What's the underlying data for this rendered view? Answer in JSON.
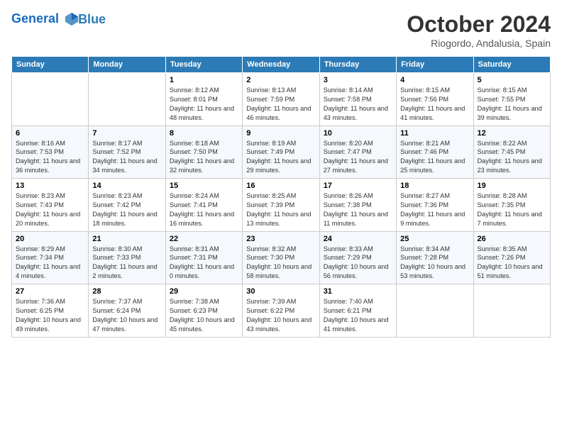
{
  "logo": {
    "line1": "General",
    "line2": "Blue"
  },
  "title": "October 2024",
  "subtitle": "Riogordo, Andalusia, Spain",
  "days_of_week": [
    "Sunday",
    "Monday",
    "Tuesday",
    "Wednesday",
    "Thursday",
    "Friday",
    "Saturday"
  ],
  "weeks": [
    [
      {
        "day": "",
        "sunrise": "",
        "sunset": "",
        "daylight": ""
      },
      {
        "day": "",
        "sunrise": "",
        "sunset": "",
        "daylight": ""
      },
      {
        "day": "1",
        "sunrise": "Sunrise: 8:12 AM",
        "sunset": "Sunset: 8:01 PM",
        "daylight": "Daylight: 11 hours and 48 minutes."
      },
      {
        "day": "2",
        "sunrise": "Sunrise: 8:13 AM",
        "sunset": "Sunset: 7:59 PM",
        "daylight": "Daylight: 11 hours and 46 minutes."
      },
      {
        "day": "3",
        "sunrise": "Sunrise: 8:14 AM",
        "sunset": "Sunset: 7:58 PM",
        "daylight": "Daylight: 11 hours and 43 minutes."
      },
      {
        "day": "4",
        "sunrise": "Sunrise: 8:15 AM",
        "sunset": "Sunset: 7:56 PM",
        "daylight": "Daylight: 11 hours and 41 minutes."
      },
      {
        "day": "5",
        "sunrise": "Sunrise: 8:15 AM",
        "sunset": "Sunset: 7:55 PM",
        "daylight": "Daylight: 11 hours and 39 minutes."
      }
    ],
    [
      {
        "day": "6",
        "sunrise": "Sunrise: 8:16 AM",
        "sunset": "Sunset: 7:53 PM",
        "daylight": "Daylight: 11 hours and 36 minutes."
      },
      {
        "day": "7",
        "sunrise": "Sunrise: 8:17 AM",
        "sunset": "Sunset: 7:52 PM",
        "daylight": "Daylight: 11 hours and 34 minutes."
      },
      {
        "day": "8",
        "sunrise": "Sunrise: 8:18 AM",
        "sunset": "Sunset: 7:50 PM",
        "daylight": "Daylight: 11 hours and 32 minutes."
      },
      {
        "day": "9",
        "sunrise": "Sunrise: 8:19 AM",
        "sunset": "Sunset: 7:49 PM",
        "daylight": "Daylight: 11 hours and 29 minutes."
      },
      {
        "day": "10",
        "sunrise": "Sunrise: 8:20 AM",
        "sunset": "Sunset: 7:47 PM",
        "daylight": "Daylight: 11 hours and 27 minutes."
      },
      {
        "day": "11",
        "sunrise": "Sunrise: 8:21 AM",
        "sunset": "Sunset: 7:46 PM",
        "daylight": "Daylight: 11 hours and 25 minutes."
      },
      {
        "day": "12",
        "sunrise": "Sunrise: 8:22 AM",
        "sunset": "Sunset: 7:45 PM",
        "daylight": "Daylight: 11 hours and 23 minutes."
      }
    ],
    [
      {
        "day": "13",
        "sunrise": "Sunrise: 8:23 AM",
        "sunset": "Sunset: 7:43 PM",
        "daylight": "Daylight: 11 hours and 20 minutes."
      },
      {
        "day": "14",
        "sunrise": "Sunrise: 8:23 AM",
        "sunset": "Sunset: 7:42 PM",
        "daylight": "Daylight: 11 hours and 18 minutes."
      },
      {
        "day": "15",
        "sunrise": "Sunrise: 8:24 AM",
        "sunset": "Sunset: 7:41 PM",
        "daylight": "Daylight: 11 hours and 16 minutes."
      },
      {
        "day": "16",
        "sunrise": "Sunrise: 8:25 AM",
        "sunset": "Sunset: 7:39 PM",
        "daylight": "Daylight: 11 hours and 13 minutes."
      },
      {
        "day": "17",
        "sunrise": "Sunrise: 8:26 AM",
        "sunset": "Sunset: 7:38 PM",
        "daylight": "Daylight: 11 hours and 11 minutes."
      },
      {
        "day": "18",
        "sunrise": "Sunrise: 8:27 AM",
        "sunset": "Sunset: 7:36 PM",
        "daylight": "Daylight: 11 hours and 9 minutes."
      },
      {
        "day": "19",
        "sunrise": "Sunrise: 8:28 AM",
        "sunset": "Sunset: 7:35 PM",
        "daylight": "Daylight: 11 hours and 7 minutes."
      }
    ],
    [
      {
        "day": "20",
        "sunrise": "Sunrise: 8:29 AM",
        "sunset": "Sunset: 7:34 PM",
        "daylight": "Daylight: 11 hours and 4 minutes."
      },
      {
        "day": "21",
        "sunrise": "Sunrise: 8:30 AM",
        "sunset": "Sunset: 7:33 PM",
        "daylight": "Daylight: 11 hours and 2 minutes."
      },
      {
        "day": "22",
        "sunrise": "Sunrise: 8:31 AM",
        "sunset": "Sunset: 7:31 PM",
        "daylight": "Daylight: 11 hours and 0 minutes."
      },
      {
        "day": "23",
        "sunrise": "Sunrise: 8:32 AM",
        "sunset": "Sunset: 7:30 PM",
        "daylight": "Daylight: 10 hours and 58 minutes."
      },
      {
        "day": "24",
        "sunrise": "Sunrise: 8:33 AM",
        "sunset": "Sunset: 7:29 PM",
        "daylight": "Daylight: 10 hours and 56 minutes."
      },
      {
        "day": "25",
        "sunrise": "Sunrise: 8:34 AM",
        "sunset": "Sunset: 7:28 PM",
        "daylight": "Daylight: 10 hours and 53 minutes."
      },
      {
        "day": "26",
        "sunrise": "Sunrise: 8:35 AM",
        "sunset": "Sunset: 7:26 PM",
        "daylight": "Daylight: 10 hours and 51 minutes."
      }
    ],
    [
      {
        "day": "27",
        "sunrise": "Sunrise: 7:36 AM",
        "sunset": "Sunset: 6:25 PM",
        "daylight": "Daylight: 10 hours and 49 minutes."
      },
      {
        "day": "28",
        "sunrise": "Sunrise: 7:37 AM",
        "sunset": "Sunset: 6:24 PM",
        "daylight": "Daylight: 10 hours and 47 minutes."
      },
      {
        "day": "29",
        "sunrise": "Sunrise: 7:38 AM",
        "sunset": "Sunset: 6:23 PM",
        "daylight": "Daylight: 10 hours and 45 minutes."
      },
      {
        "day": "30",
        "sunrise": "Sunrise: 7:39 AM",
        "sunset": "Sunset: 6:22 PM",
        "daylight": "Daylight: 10 hours and 43 minutes."
      },
      {
        "day": "31",
        "sunrise": "Sunrise: 7:40 AM",
        "sunset": "Sunset: 6:21 PM",
        "daylight": "Daylight: 10 hours and 41 minutes."
      },
      {
        "day": "",
        "sunrise": "",
        "sunset": "",
        "daylight": ""
      },
      {
        "day": "",
        "sunrise": "",
        "sunset": "",
        "daylight": ""
      }
    ]
  ]
}
